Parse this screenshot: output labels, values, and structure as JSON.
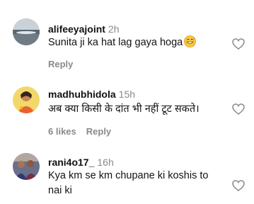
{
  "comments": [
    {
      "username": "alifeeyajoint",
      "time": "2h",
      "text": "Sunita ji ka hat lag gaya hoga",
      "emoji": "grinning-sweat-emoji",
      "reply_label": "Reply",
      "likes_label": ""
    },
    {
      "username": "madhubhidola",
      "time": "15h",
      "text": "अब क्या किसी के दांत भी नहीं टूट सकते।",
      "reply_label": "Reply",
      "likes_label": "6 likes"
    },
    {
      "username": "rani4o17_",
      "time": "16h",
      "text_lines": [
        "Kya km se km chupane ki koshis to",
        "nai ki"
      ],
      "reply_label": "",
      "likes_label": ""
    }
  ],
  "colors": {
    "text": "#121212",
    "muted": "#8a8a8a",
    "background": "#ffffff"
  },
  "icons": {
    "like": "heart-outline-icon"
  }
}
